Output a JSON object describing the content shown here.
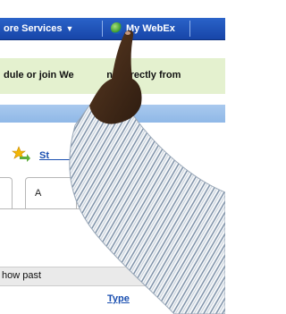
{
  "navbar": {
    "more_services_label": "ore Services",
    "more_services_icon": "caret-down-icon",
    "my_webex_label": "My WebEx",
    "my_webex_icon": "globe-icon"
  },
  "banner": {
    "text": "dule or join We            ng directly from"
  },
  "meeting": {
    "icon": "star-arrow-icon",
    "link_text": "St                lick Meeting"
  },
  "tabs": [
    {
      "label": ""
    },
    {
      "label": "A"
    }
  ],
  "list": {
    "show_text": "how past",
    "type_header": "Type"
  },
  "colors": {
    "navbar": "#1f56bd",
    "banner": "#e4f1cf",
    "section_bar": "#9dc0ea",
    "link": "#1a4fb0"
  }
}
